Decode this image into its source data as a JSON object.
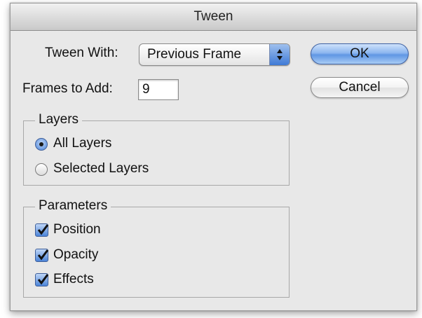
{
  "window": {
    "title": "Tween"
  },
  "tween_with": {
    "label": "Tween With:",
    "value": "Previous Frame"
  },
  "frames_to_add": {
    "label": "Frames to Add:",
    "value": "9"
  },
  "buttons": {
    "ok": "OK",
    "cancel": "Cancel"
  },
  "layers": {
    "title": "Layers",
    "options": [
      {
        "label": "All Layers",
        "selected": true
      },
      {
        "label": "Selected Layers",
        "selected": false
      }
    ]
  },
  "parameters": {
    "title": "Parameters",
    "options": [
      {
        "label": "Position",
        "checked": true
      },
      {
        "label": "Opacity",
        "checked": true
      },
      {
        "label": "Effects",
        "checked": true
      }
    ]
  },
  "colors": {
    "accent_blue": "#4b84d8",
    "dialog_bg": "#e8e8e8"
  },
  "icons": {
    "select_arrows": "up-down-arrows-icon",
    "radio_selected": "radio-selected-icon",
    "checkmark": "checkmark-icon"
  }
}
